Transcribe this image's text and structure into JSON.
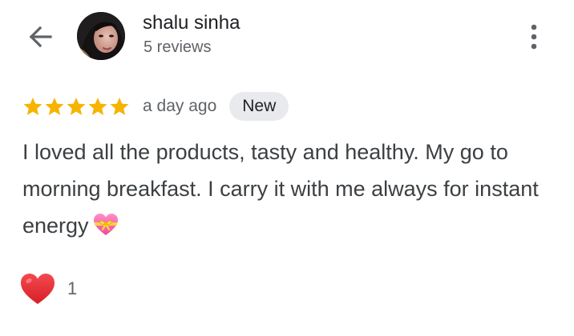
{
  "reviewer": {
    "name": "shalu sinha",
    "reviews_count": "5 reviews"
  },
  "review": {
    "rating": 5,
    "max_rating": 5,
    "date": "a day ago",
    "badge": "New",
    "text": "I loved all the products, tasty and healthy. My go to morning breakfast. I carry it with me always for instant energy",
    "emoji": "heart-with-ribbon"
  },
  "reactions": {
    "heart_count": "1"
  },
  "icons": {
    "back": "arrow-back-icon",
    "more": "more-vert-icon",
    "star": "star-icon",
    "reaction": "heart-icon"
  },
  "colors": {
    "star": "#f6b400",
    "heart": "#e0262d",
    "badge_bg": "#e8eaed",
    "text": "#3c4043",
    "secondary_text": "#5f6368"
  }
}
